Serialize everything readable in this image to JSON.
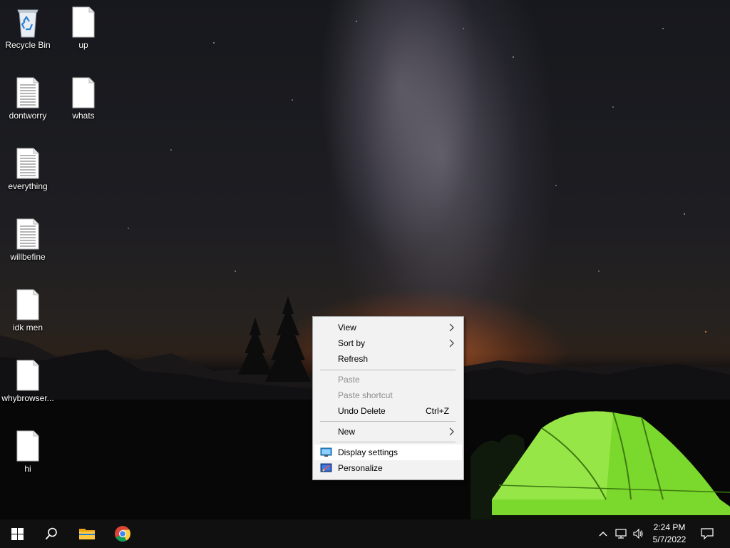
{
  "desktop": {
    "icons": [
      {
        "label": "Recycle Bin",
        "icon": "recycle-bin-icon"
      },
      {
        "label": "up",
        "icon": "blank-file-icon"
      },
      {
        "label": "dontworry",
        "icon": "text-file-icon"
      },
      {
        "label": "whats",
        "icon": "blank-file-icon"
      },
      {
        "label": "everything",
        "icon": "text-file-icon"
      },
      {
        "label": "willbefine",
        "icon": "text-file-icon"
      },
      {
        "label": "idk men",
        "icon": "blank-file-icon"
      },
      {
        "label": "whybrowser...",
        "icon": "blank-file-icon"
      },
      {
        "label": "hi",
        "icon": "blank-file-icon"
      }
    ]
  },
  "context_menu": {
    "view": "View",
    "sort_by": "Sort by",
    "refresh": "Refresh",
    "paste": "Paste",
    "paste_shortcut": "Paste shortcut",
    "undo_delete": "Undo Delete",
    "undo_delete_shortcut": "Ctrl+Z",
    "new": "New",
    "display_settings": "Display settings",
    "personalize": "Personalize",
    "hovered_item": "Display settings"
  },
  "taskbar": {
    "start": "windows-logo-icon",
    "search": "search-icon",
    "pinned": [
      "file-explorer-icon",
      "chrome-icon"
    ],
    "tray_icons": [
      "chevron-up-icon",
      "network-icon",
      "speaker-icon"
    ],
    "time": "2:24 PM",
    "date": "5/7/2022",
    "action_center": "notification-icon"
  },
  "colors": {
    "taskbar": "#101010",
    "menu_bg": "#f2f2f2",
    "menu_disabled_text": "#8d8d8d",
    "tent_green": "#7bd82c"
  }
}
